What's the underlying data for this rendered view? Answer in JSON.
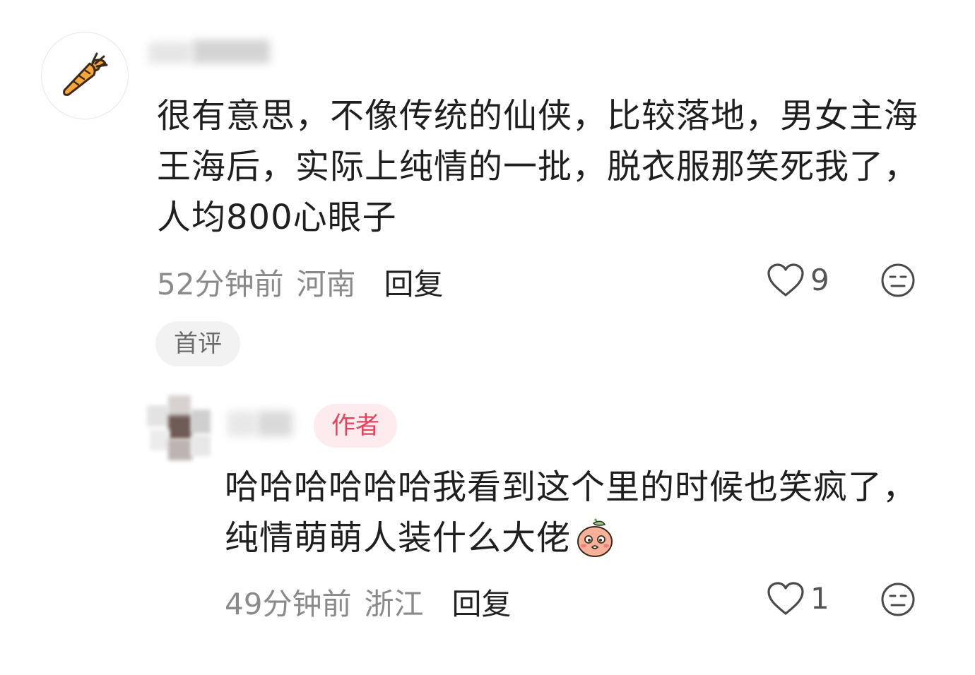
{
  "comment1": {
    "text": "很有意思，不像传统的仙侠，比较落地，男女主海王海后，实际上纯情的一批，脱衣服那笑死我了，人均800心眼子",
    "time": "52分钟前",
    "location": "河南",
    "reply_label": "回复",
    "likes": "9",
    "badge": "首评",
    "avatar_icon": "carrot-icon"
  },
  "comment2": {
    "author_badge": "作者",
    "text": "哈哈哈哈哈哈我看到这个里的时候也笑疯了，纯情萌萌人装什么大佬",
    "inline_emoji": "embarrassed-peach-emoji",
    "time": "49分钟前",
    "location": "浙江",
    "reply_label": "回复",
    "likes": "1"
  },
  "colors": {
    "author_badge_bg": "#fdebee",
    "author_badge_text": "#e2455d",
    "meta_gray": "#8a8a8a",
    "badge_bg": "#f2f2f2"
  }
}
